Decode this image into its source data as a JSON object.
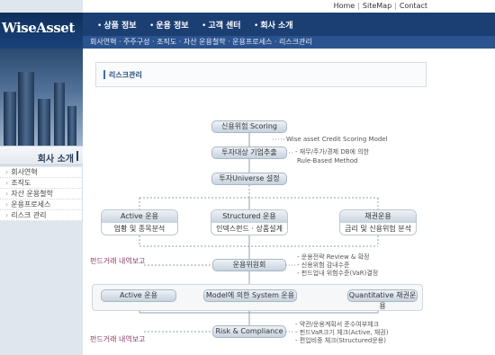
{
  "util_links": [
    "Home",
    "SiteMap",
    "Contact"
  ],
  "logo": "WiseAsset",
  "nav": [
    {
      "label": "상품 정보"
    },
    {
      "label": "운용 정보"
    },
    {
      "label": "고객 센터"
    },
    {
      "label": "회사 소개"
    }
  ],
  "subnav": "회사연혁 · 주주구성 · 조직도 · 자산 운용철학 · 운용프로세스 · 리스크관리",
  "sidebar": {
    "title": "회사 소개",
    "items": [
      "회사연혁",
      "조직도",
      "자산 운용철학",
      "운용프로세스",
      "리스크 관리"
    ]
  },
  "page_title": "리스크관리",
  "diagram": {
    "scoring": "신용위험 Scoring",
    "scoring_note": "Wise asset Credit Scoring Model",
    "investee": "투자대상 기업추출",
    "investee_note1": "- 재무/주가/경제 DB에 의한",
    "investee_note2": "Rule-Based Method",
    "universe": "투자Universe 설정",
    "active_hd": "Active 운용",
    "active_bd": "업황 및 종목분석",
    "structured_hd": "Structured 운용",
    "structured_bd": "인덱스펀드 · 상품설계",
    "bond_hd": "채권운용",
    "bond_bd": "금리 및 신용위험 분석",
    "fund_manager_report1": "펀드거래 내역보고",
    "committee": "운용위원회",
    "committee_notes": [
      "- 운용전략 Review & 확정",
      "- 신용위험 감내수준",
      "- 펀드업내 위험수준(VaR)결정"
    ],
    "active_exec": "Active 운용",
    "model_exec": "Model에 의한 System 운용",
    "quant_exec": "Quantitative 채권운용",
    "fund_manager_report2": "펀드거래 내역보고",
    "compliance": "Risk & Compliance",
    "compliance_notes": [
      "- 약관/운용계획서 준수여부체크",
      "- 펀드VaR크기 체크(Active, 채권)",
      "- 편입비중 체크(Structured운용)"
    ]
  }
}
